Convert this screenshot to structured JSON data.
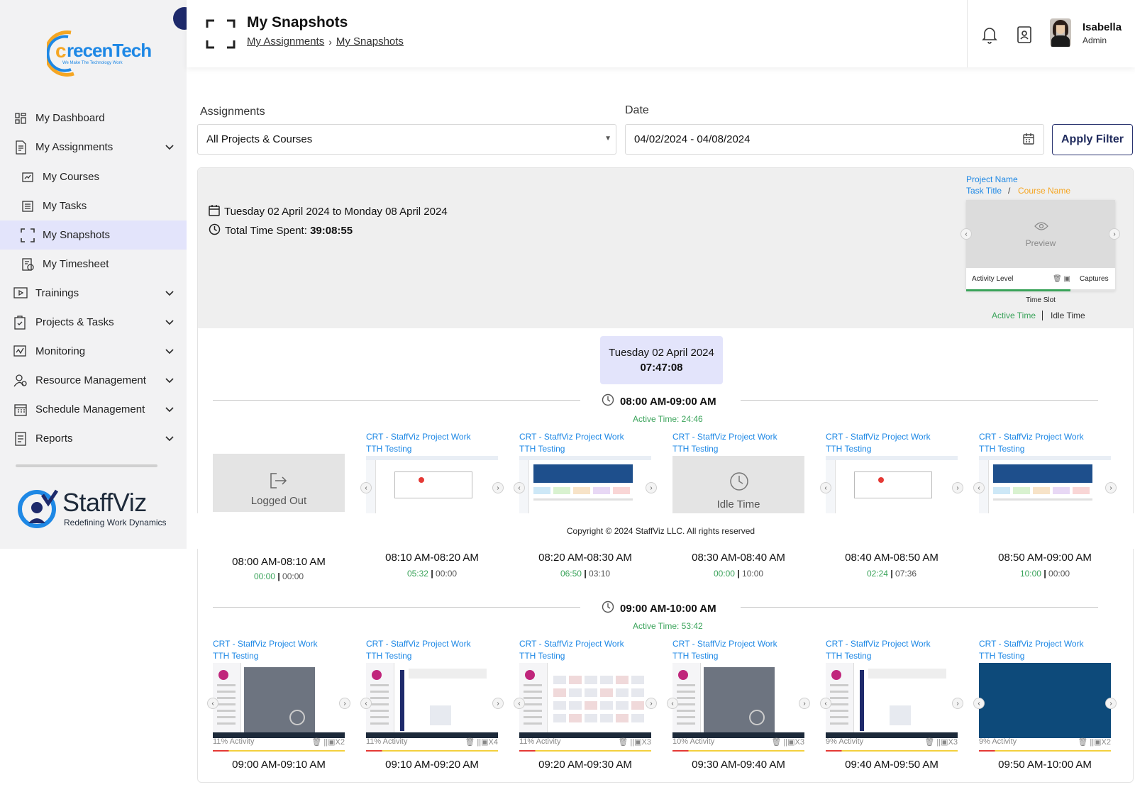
{
  "brand": {
    "top_logo_text": "recenTech",
    "top_logo_prefix": "c",
    "top_logo_tagline": "We Make The Technology Work",
    "bottom_logo_text": "StaffViz",
    "bottom_logo_tagline": "Redefining Work Dynamics"
  },
  "sidebar": {
    "items": [
      {
        "label": "My Dashboard",
        "icon": "dashboard-icon"
      },
      {
        "label": "My Assignments",
        "icon": "assignments-icon",
        "expandable": true
      },
      {
        "label": "My Courses",
        "icon": "courses-icon"
      },
      {
        "label": "My Tasks",
        "icon": "tasks-icon"
      },
      {
        "label": "My Snapshots",
        "icon": "snapshots-icon",
        "active": true
      },
      {
        "label": "My Timesheet",
        "icon": "timesheet-icon"
      },
      {
        "label": "Trainings",
        "icon": "trainings-icon",
        "expandable": true
      },
      {
        "label": "Projects & Tasks",
        "icon": "projects-icon",
        "expandable": true
      },
      {
        "label": "Monitoring",
        "icon": "monitoring-icon",
        "expandable": true
      },
      {
        "label": "Resource Management",
        "icon": "resource-icon",
        "expandable": true
      },
      {
        "label": "Schedule Management",
        "icon": "schedule-icon",
        "expandable": true
      },
      {
        "label": "Reports",
        "icon": "reports-icon",
        "expandable": true
      }
    ]
  },
  "header": {
    "title": "My Snapshots",
    "breadcrumb": [
      "My Assignments",
      "My Snapshots"
    ],
    "user_name": "Isabella",
    "user_role": "Admin"
  },
  "filter": {
    "assignments_label": "Assignments",
    "assignments_value": "All Projects & Courses",
    "date_label": "Date",
    "date_value": "04/02/2024 - 04/08/2024",
    "apply_label": "Apply Filter"
  },
  "summary": {
    "range": "Tuesday 02 April 2024 to Monday 08 April 2024",
    "total_label": "Total Time Spent: ",
    "total_value": "39:08:55"
  },
  "legend": {
    "project_name": "Project Name",
    "task_title": "Task Title",
    "separator": "/",
    "course_name": "Course Name",
    "preview": "Preview",
    "activity_level": "Activity Level",
    "captures": "Captures",
    "time_slot": "Time Slot",
    "active_time": "Active Time",
    "idle_time": "Idle Time"
  },
  "day": {
    "date": "Tuesday 02 April 2024",
    "total": "07:47:08"
  },
  "hours": [
    {
      "title": "08:00 AM-09:00 AM",
      "active": "Active Time: 24:46",
      "cards": [
        {
          "type": "logged-out",
          "label": "Logged Out",
          "slot": "08:00 AM-08:10 AM",
          "active": "00:00",
          "idle": "00:00"
        },
        {
          "type": "shot",
          "project": "CRT - StaffViz Project Work",
          "task": "TTH Testing",
          "slot": "08:10 AM-08:20 AM",
          "active": "05:32",
          "idle": "00:00"
        },
        {
          "type": "shot",
          "project": "CRT - StaffViz Project Work",
          "task": "TTH Testing",
          "slot": "08:20 AM-08:30 AM",
          "active": "06:50",
          "idle": "03:10"
        },
        {
          "type": "idle",
          "project": "CRT - StaffViz Project Work",
          "task": "TTH Testing",
          "label": "Idle Time",
          "slot": "08:30 AM-08:40 AM",
          "active": "00:00",
          "idle": "10:00"
        },
        {
          "type": "shot",
          "project": "CRT - StaffViz Project Work",
          "task": "TTH Testing",
          "slot": "08:40 AM-08:50 AM",
          "active": "02:24",
          "idle": "07:36"
        },
        {
          "type": "shot",
          "project": "CRT - StaffViz Project Work",
          "task": "TTH Testing",
          "slot": "08:50 AM-09:00 AM",
          "active": "10:00",
          "idle": "00:00"
        }
      ]
    },
    {
      "title": "09:00 AM-10:00 AM",
      "active": "Active Time: 53:42",
      "cards": [
        {
          "type": "shot",
          "project": "CRT - StaffViz Project Work",
          "task": "TTH Testing",
          "activity": "11% Activity",
          "captures": "X2",
          "slot": "09:00 AM-09:10 AM"
        },
        {
          "type": "shot",
          "project": "CRT - StaffViz Project Work",
          "task": "TTH Testing",
          "activity": "11% Activity",
          "captures": "X4",
          "slot": "09:10 AM-09:20 AM"
        },
        {
          "type": "shot",
          "project": "CRT - StaffViz Project Work",
          "task": "TTH Testing",
          "activity": "11% Activity",
          "captures": "X3",
          "slot": "09:20 AM-09:30 AM"
        },
        {
          "type": "shot",
          "project": "CRT - StaffViz Project Work",
          "task": "TTH Testing",
          "activity": "10% Activity",
          "captures": "X3",
          "slot": "09:30 AM-09:40 AM"
        },
        {
          "type": "shot",
          "project": "CRT - StaffViz Project Work",
          "task": "TTH Testing",
          "activity": "9% Activity",
          "captures": "X3",
          "slot": "09:40 AM-09:50 AM"
        },
        {
          "type": "blue",
          "project": "CRT - StaffViz Project Work",
          "task": "TTH Testing",
          "activity": "9% Activity",
          "captures": "X2",
          "slot": "09:50 AM-10:00 AM"
        }
      ]
    }
  ],
  "footer": {
    "copyright": "Copyright © 2024 StaffViz LLC. All rights reserved"
  },
  "colors": {
    "accent": "#1e88e5",
    "active_green": "#3aa35a",
    "course_orange": "#f5a623",
    "navy": "#1e2a6b",
    "active_nav_bg": "#e3e4fb"
  }
}
